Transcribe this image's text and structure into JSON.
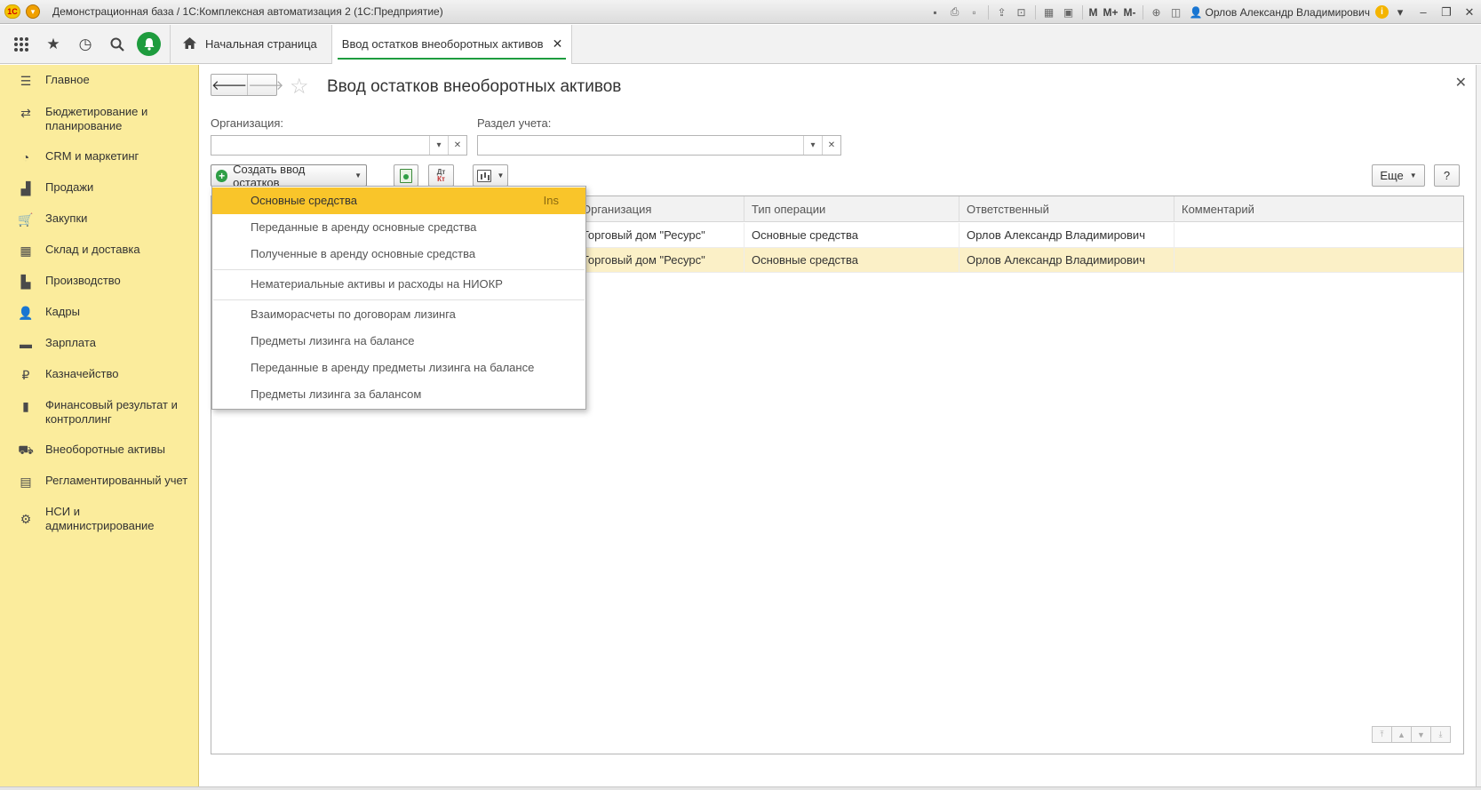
{
  "window": {
    "title": "Демонстрационная база / 1С:Комплексная автоматизация 2  (1С:Предприятие)",
    "logo": "1С",
    "user": "Орлов Александр Владимирович",
    "m_buttons": [
      "M",
      "M+",
      "M-"
    ]
  },
  "navbar": {
    "home_tab": "Начальная страница",
    "doc_tab": "Ввод остатков внеоборотных активов"
  },
  "sidebar": {
    "items": [
      {
        "label": "Главное",
        "icon": "menu-icon"
      },
      {
        "label": "Бюджетирование и планирование",
        "icon": "budget-icon"
      },
      {
        "label": "CRM и маркетинг",
        "icon": "pie-chart-icon"
      },
      {
        "label": "Продажи",
        "icon": "bag-icon"
      },
      {
        "label": "Закупки",
        "icon": "cart-icon"
      },
      {
        "label": "Склад и доставка",
        "icon": "warehouse-icon"
      },
      {
        "label": "Производство",
        "icon": "factory-icon"
      },
      {
        "label": "Кадры",
        "icon": "person-icon"
      },
      {
        "label": "Зарплата",
        "icon": "wallet-icon"
      },
      {
        "label": "Казначейство",
        "icon": "ruble-icon"
      },
      {
        "label": "Финансовый результат и контроллинг",
        "icon": "bar-chart-icon"
      },
      {
        "label": "Внеоборотные активы",
        "icon": "truck-icon"
      },
      {
        "label": "Регламентированный учет",
        "icon": "report-icon"
      },
      {
        "label": "НСИ и администрирование",
        "icon": "gear-icon"
      }
    ]
  },
  "form": {
    "title": "Ввод остатков внеоборотных активов",
    "org_label": "Организация:",
    "org_value": "",
    "section_label": "Раздел учета:",
    "section_value": "",
    "create_button": "Создать ввод остатков",
    "more_button": "Еще",
    "help_button": "?",
    "dtkt_top": "Дт",
    "dtkt_bottom": "Кт"
  },
  "table": {
    "columns": [
      "Организация",
      "Тип операции",
      "Ответственный",
      "Комментарий"
    ],
    "rows": [
      {
        "org": "Торговый дом \"Ресурс\"",
        "op": "Основные средства",
        "resp": "Орлов Александр Владимирович",
        "comment": ""
      },
      {
        "org": "Торговый дом \"Ресурс\"",
        "op": "Основные средства",
        "resp": "Орлов Александр Владимирович",
        "comment": ""
      }
    ],
    "visible_fragments": [
      "изация",
      "ресурс",
      "ресурс"
    ]
  },
  "dropdown": {
    "items": [
      {
        "label": "Основные средства",
        "shortcut": "Ins",
        "active": true
      },
      {
        "label": "Переданные в аренду основные средства"
      },
      {
        "label": "Полученные в аренду основные средства"
      },
      {
        "label": "Нематериальные активы и расходы на НИОКР"
      },
      {
        "label": "Взаиморасчеты по договорам лизинга"
      },
      {
        "label": "Предметы лизинга на балансе"
      },
      {
        "label": "Переданные в аренду предметы лизинга на балансе"
      },
      {
        "label": "Предметы лизинга за балансом"
      }
    ]
  },
  "colors": {
    "sidebar_bg": "#fbec9c",
    "accent_green": "#1e9c3e",
    "menu_highlight": "#f9c52a",
    "selected_row": "#fbf0c7"
  }
}
